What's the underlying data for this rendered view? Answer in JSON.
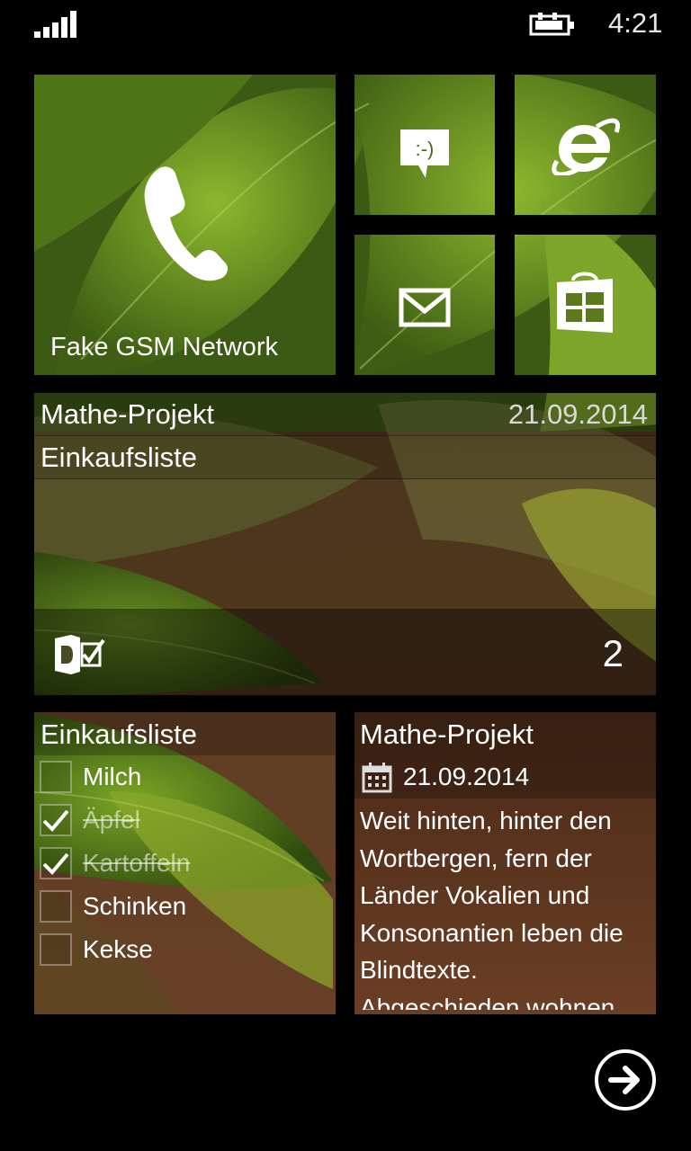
{
  "status": {
    "time": "4:21",
    "signal_icon": "signal-strength-icon",
    "battery_icon": "battery-charging-icon"
  },
  "tiles": {
    "phone": {
      "label": "Fake GSM Network",
      "icon": "phone-icon"
    },
    "messaging": {
      "icon": "messaging-smiley-icon",
      "icon_text": ":-)"
    },
    "ie": {
      "icon": "internet-explorer-icon"
    },
    "mail": {
      "icon": "mail-envelope-icon"
    },
    "store": {
      "icon": "store-bag-icon"
    },
    "tasks_wide": {
      "row1_title": "Mathe-Projekt",
      "row1_date": "21.09.2014",
      "row2_title": "Einkaufsliste",
      "app_icon": "todo-app-icon",
      "count": "2"
    },
    "shopping_list": {
      "title": "Einkaufsliste",
      "items": [
        {
          "label": "Milch",
          "checked": false
        },
        {
          "label": "Äpfel",
          "checked": true
        },
        {
          "label": "Kartoffeln",
          "checked": true
        },
        {
          "label": "Schinken",
          "checked": false
        },
        {
          "label": "Kekse",
          "checked": false
        }
      ]
    },
    "note": {
      "title": "Mathe-Projekt",
      "date": "21.09.2014",
      "date_icon": "calendar-icon",
      "body_lines": [
        "Weit hinten, hinter den",
        "Wortbergen, fern der",
        "Länder Vokalien und",
        "Konsonantien leben die",
        "Blindtexte.",
        "Abgeschieden wohnen"
      ]
    }
  },
  "footer": {
    "next_icon": "arrow-right-circle-icon"
  },
  "colors": {
    "leaf_bright": "#6f9a22",
    "leaf_dark": "#3c5a12",
    "brown": "#5a3a24",
    "background": "#000000"
  }
}
